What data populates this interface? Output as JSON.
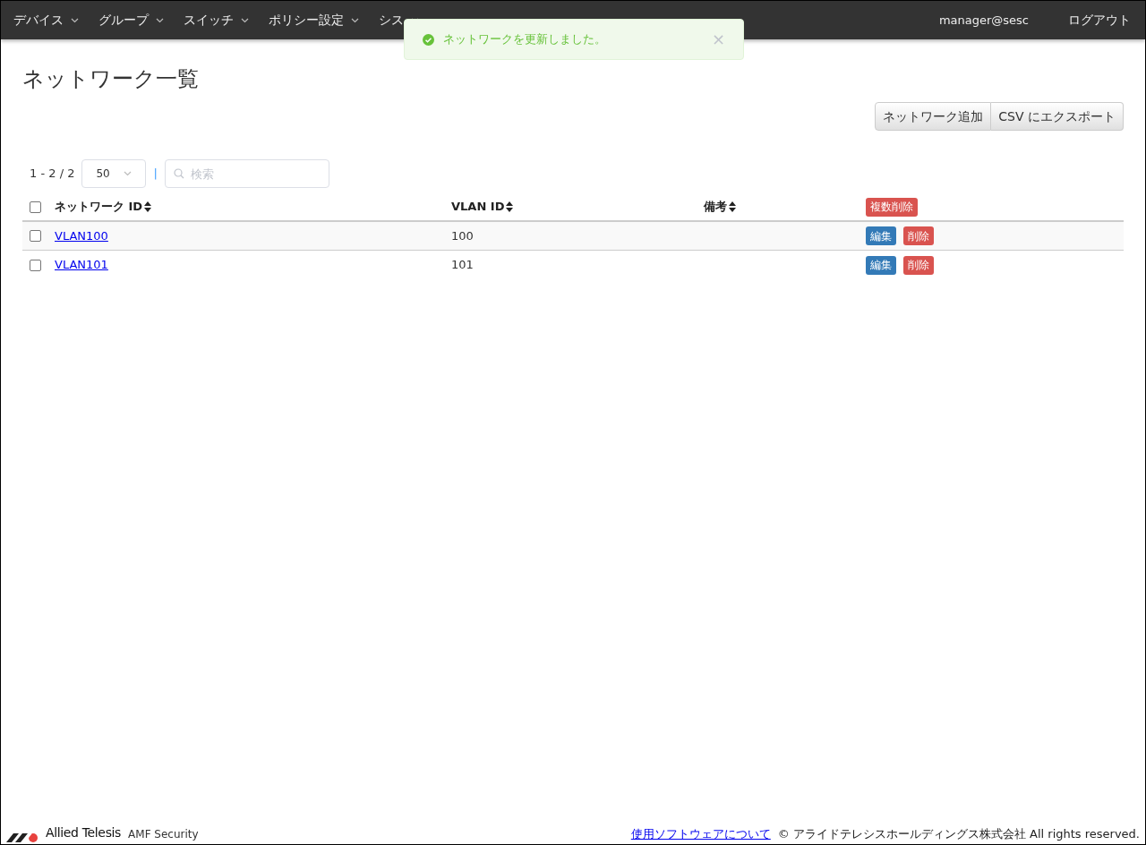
{
  "nav": {
    "menus": [
      {
        "label": "デバイス"
      },
      {
        "label": "グループ"
      },
      {
        "label": "スイッチ"
      },
      {
        "label": "ポリシー設定"
      },
      {
        "label": "シス"
      }
    ],
    "user": "manager@sesc",
    "logout": "ログアウト"
  },
  "toast": {
    "message": "ネットワークを更新しました。",
    "close": "×"
  },
  "page": {
    "title": "ネットワーク一覧",
    "buttons": [
      "ネットワーク追加",
      "CSV にエクスポート"
    ]
  },
  "toolbar": {
    "range": "1 - 2 / 2",
    "page_size": "50",
    "separator": "|",
    "search_placeholder": "検索"
  },
  "table": {
    "all_checked": false,
    "columns": [
      "ネットワーク ID",
      "VLAN ID",
      "備考"
    ],
    "bulk_delete": "複数削除",
    "rows": [
      {
        "checked": false,
        "network_id": "VLAN100",
        "vlan_id": "100",
        "edit": "編集",
        "delete": "削除"
      },
      {
        "checked": false,
        "network_id": "VLAN101",
        "vlan_id": "101",
        "edit": "編集",
        "delete": "削除"
      }
    ]
  },
  "footer": {
    "brand": "Allied Telesis",
    "product": "AMF Security",
    "link": "使用ソフトウェアについて",
    "copyright": "© アライドテレシスホールディングス株式会社 All rights reserved."
  }
}
